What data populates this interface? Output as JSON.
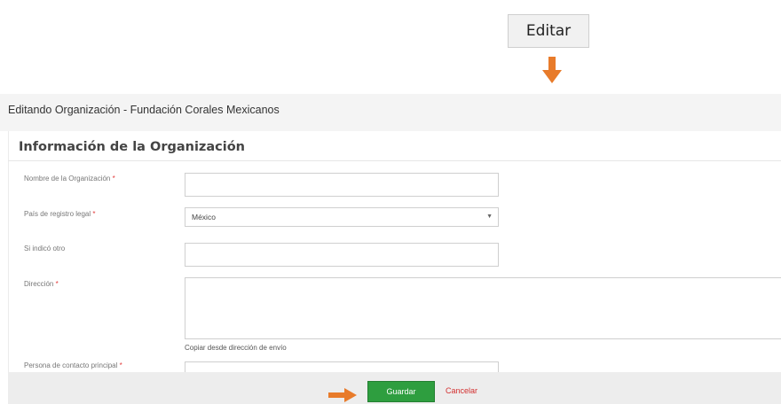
{
  "callout": {
    "editar_label": "Editar",
    "accent_color": "#e87b2a"
  },
  "header": {
    "title": "Editando Organización - Fundación Corales Mexicanos"
  },
  "section": {
    "title": "Información de la Organización"
  },
  "form": {
    "fields": [
      {
        "label": "Nombre de la Organización",
        "required_mark": "*",
        "value": ""
      },
      {
        "label": "País de registro legal",
        "required_mark": "*",
        "value": "México"
      },
      {
        "label": "Si indicó otro",
        "required_mark": "",
        "value": ""
      },
      {
        "label": "Dirección",
        "required_mark": "*",
        "value": ""
      },
      {
        "label": "Persona de contacto principal",
        "required_mark": "*",
        "value": ""
      }
    ],
    "copy_address_link": "Copiar desde dirección de envío"
  },
  "footer": {
    "save_label": "Guardar",
    "cancel_label": "Cancelar",
    "save_color": "#2e9e3f",
    "cancel_color": "#d32f2f"
  }
}
